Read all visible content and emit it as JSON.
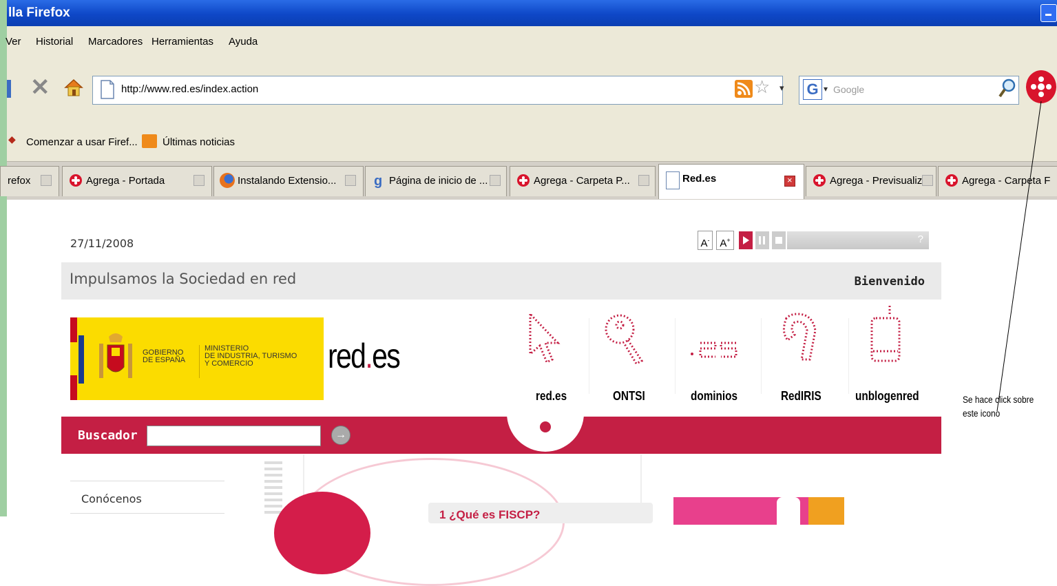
{
  "window": {
    "title": "lla Firefox"
  },
  "menu": [
    "Ver",
    "Historial",
    "Marcadores",
    "Herramientas",
    "Ayuda"
  ],
  "navbar": {
    "url": "http://www.red.es/index.action",
    "search_placeholder": "Google"
  },
  "bookmarks": [
    "Comenzar a usar Firef...",
    "Últimas noticias"
  ],
  "tabs": [
    {
      "label": "refox",
      "icon": "page-icon"
    },
    {
      "label": "Agrega - Portada",
      "icon": "agrega-icon"
    },
    {
      "label": "Instalando Extensio...",
      "icon": "firefox-icon"
    },
    {
      "label": "Página de inicio de ...",
      "icon": "google-icon"
    },
    {
      "label": "Agrega - Carpeta P...",
      "icon": "agrega-icon"
    },
    {
      "label": "Red.es",
      "icon": "page-icon",
      "active": true
    },
    {
      "label": "Agrega - Previsualiz...",
      "icon": "agrega-icon"
    },
    {
      "label": "Agrega - Carpeta F",
      "icon": "agrega-icon"
    }
  ],
  "page": {
    "date": "27/11/2008",
    "font_smaller": "A",
    "font_larger": "A",
    "help": "?",
    "slogan": "Impulsamos la Sociedad en red",
    "welcome": "Bienvenido",
    "gov_line1": "GOBIERNO",
    "gov_line2": "DE ESPAÑA",
    "min_line1": "MINISTERIO",
    "min_line2": "DE INDUSTRIA, TURISMO",
    "min_line3": "Y COMERCIO",
    "logo_red": "red",
    "logo_dot": ".",
    "logo_es": "es",
    "nav": [
      "red.es",
      "ONTSI",
      "dominios",
      "RedIRIS",
      "unblogenred"
    ],
    "search_label": "Buscador",
    "sidebar_first": "Conócenos",
    "news_title": "1 ¿Qué es FISCP?"
  },
  "annotation": {
    "line1": "Se hace click sobre",
    "line2": "este icono"
  },
  "colors": {
    "brand_red": "#c41f44",
    "titlebar_blue": "#0e47c7",
    "chrome": "#ece9d8"
  }
}
